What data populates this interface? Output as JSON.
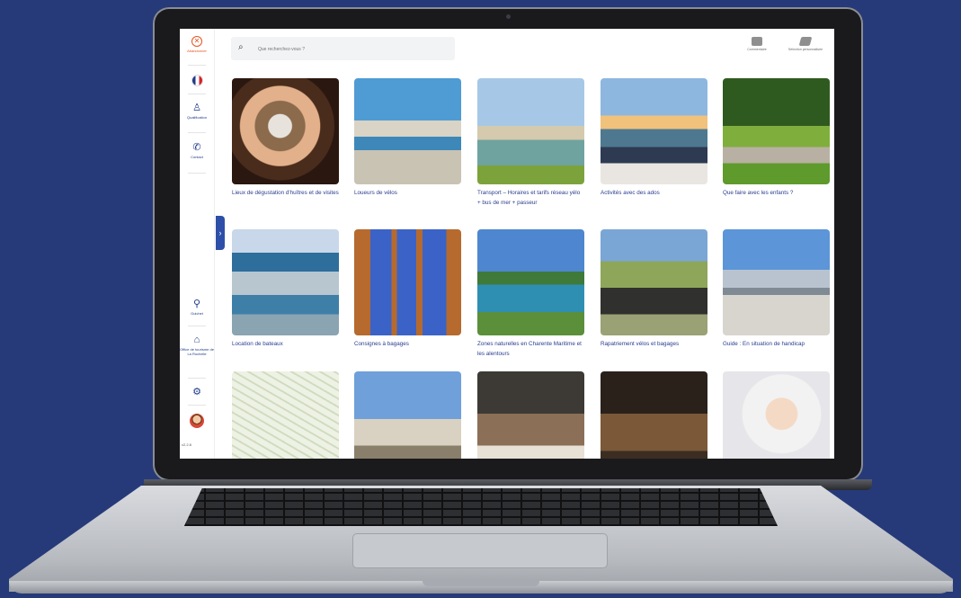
{
  "sidebar": {
    "close_label": "Abandonner",
    "language": "FR",
    "qualification_label": "Qualification",
    "contact_label": "Contact",
    "guichet_label": "Guichet",
    "office_label": "Office de tourisme de La Rochelle",
    "version": "v2.2.8"
  },
  "search": {
    "placeholder": "Que recherchez-vous ?"
  },
  "toolbar": {
    "comments_label": "Commentaire",
    "selection_label": "Sélection personnalisée"
  },
  "cards": [
    {
      "title": "Lieux de dégustation d'huîtres et de visites"
    },
    {
      "title": "Loueurs de vélos"
    },
    {
      "title": "Transport – Horaires et tarifs réseau yélo + bus de mer + passeur"
    },
    {
      "title": "Activités avec des ados"
    },
    {
      "title": "Que faire avec les enfants ?"
    },
    {
      "title": "Location de bateaux"
    },
    {
      "title": "Consignes à bagages"
    },
    {
      "title": "Zones naturelles en Charente Maritime et les alentours"
    },
    {
      "title": "Rapatriement vélos et bagages"
    },
    {
      "title": "Guide : En situation de handicap"
    },
    {
      "title": ""
    },
    {
      "title": ""
    },
    {
      "title": ""
    },
    {
      "title": ""
    },
    {
      "title": ""
    }
  ],
  "colors": {
    "background": "#263a7a",
    "accent": "#2e4fa8",
    "link": "#2a3d8f",
    "close": "#e8531e"
  }
}
